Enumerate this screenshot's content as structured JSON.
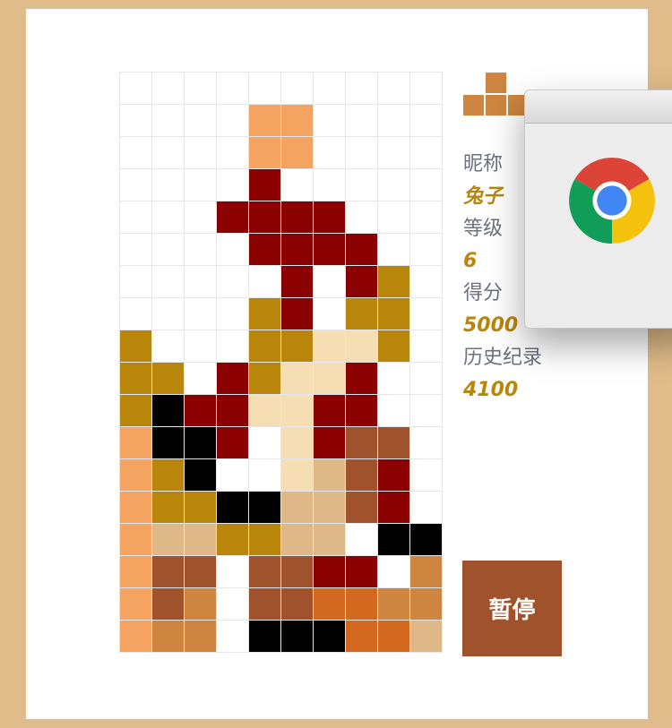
{
  "colors": {
    "empty": "#ffffff",
    "O": "#f4a460",
    "R": "#8b0000",
    "G": "#b8860b",
    "W": "#f5deb3",
    "B": "#000000",
    "K": "#a0522d",
    "T": "#deb887",
    "P": "#cd853f",
    "D": "#d2691e"
  },
  "board": {
    "rows": [
      "..........",
      "....OO....",
      "....OO....",
      "....R.....",
      "...RRRR...",
      "....RRRR..",
      ".....R.RG.",
      "....GR.GG.",
      "G...GGWWG.",
      "GG.RGWWR..",
      "GBRRWWRR..",
      "OBBR.WRKK.",
      "OGB..WTKR.",
      "OGGBBTTKR.",
      "OTTGGTT.BB",
      "OKK.KKRR.P",
      "OKP.KKDDPP",
      "OPP.BBBDDT"
    ]
  },
  "next_piece": {
    "rows": [
      ".P.",
      "PPP"
    ]
  },
  "info": {
    "nickname_label": "昵称",
    "nickname_value": "兔子",
    "level_label": "等级",
    "level_value": "6",
    "score_label": "得分",
    "score_value": "5000",
    "record_label": "历史纪录",
    "record_value": "4100"
  },
  "pause_button": {
    "label": "暂停"
  },
  "popup": {
    "icon": "chrome-icon"
  }
}
